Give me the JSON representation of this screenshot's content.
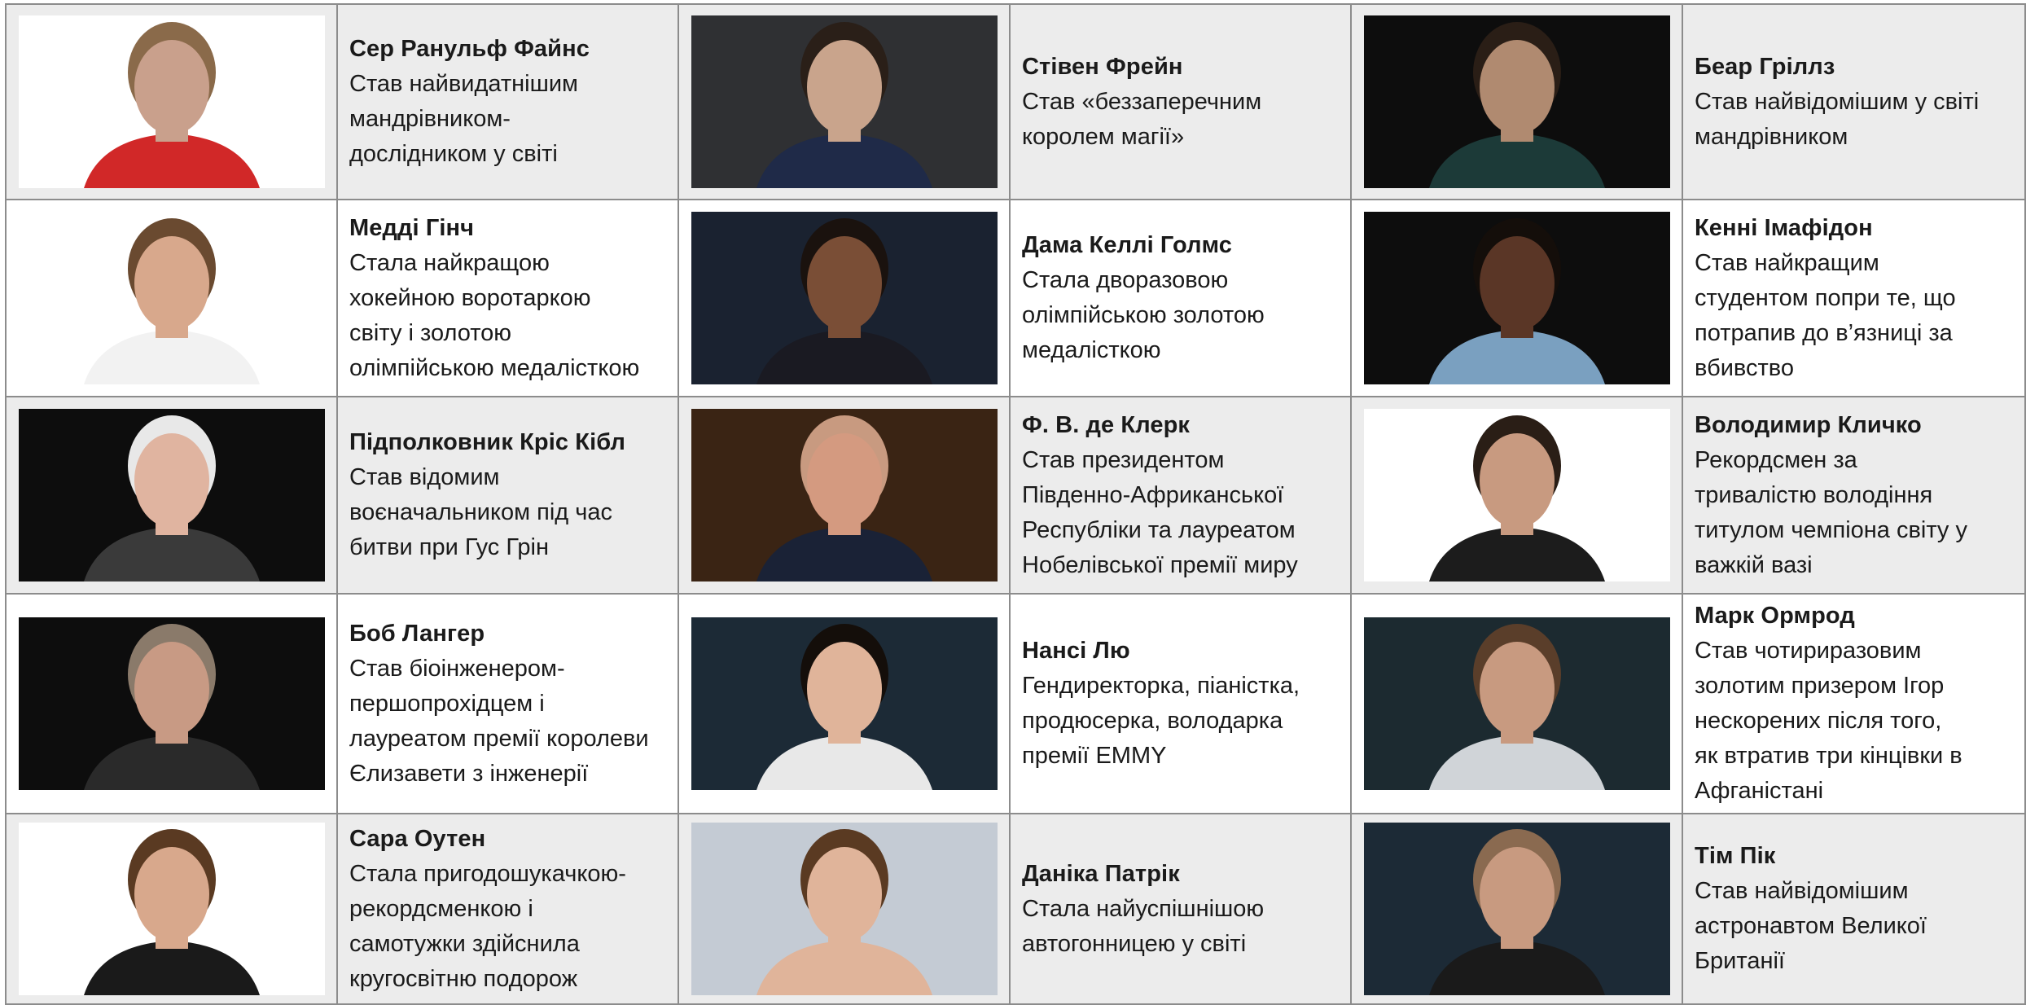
{
  "people": [
    {
      "name": "Сер Ранульф Файнс",
      "description": "Став найвидатнішим\nмандрівником-\nдослідником у світі",
      "photo_bg": "#ffffff",
      "skin": "#c9a08c",
      "hair": "#8a6a4a",
      "cloth": "#d12828"
    },
    {
      "name": "Стівен Фрейн",
      "description": "Став «беззаперечним\nкоролем магії»",
      "photo_bg": "#2f3033",
      "skin": "#c9a48c",
      "hair": "#2a1f18",
      "cloth": "#1f2a48"
    },
    {
      "name": "Беар Гріллз",
      "description": "Став найвідомішим у світі\nмандрівником",
      "photo_bg": "#0d0d0d",
      "skin": "#b08a70",
      "hair": "#2a1e16",
      "cloth": "#1c3a38"
    },
    {
      "name": "Медді Гінч",
      "description": "Стала найкращою\nхокейною воротаркою\nсвіту і золотою\nолімпійською медалісткою",
      "photo_bg": "#ffffff",
      "skin": "#d8a88c",
      "hair": "#6a4a30",
      "cloth": "#f2f2f2"
    },
    {
      "name": "Дама Келлі Голмс",
      "description": "Стала дворазовою\nолімпійською золотою\nмедалісткою",
      "photo_bg": "#1a2230",
      "skin": "#7a4e36",
      "hair": "#1a120e",
      "cloth": "#1a1a22"
    },
    {
      "name": "Кенні Імафідон",
      "description": "Став найкращим\nстудентом попри те, що\nпотрапив до в’язниці за\nвбивство",
      "photo_bg": "#0d0d0d",
      "skin": "#5a3626",
      "hair": "#140e0a",
      "cloth": "#7aa0c0"
    },
    {
      "name": "Підполковник Кріс Кібл",
      "description": "Став відомим\nвоєначальником під час\nбитви при Гус Грін",
      "photo_bg": "#0d0d0d",
      "skin": "#e0b4a0",
      "hair": "#e8e8e8",
      "cloth": "#3a3a3a"
    },
    {
      "name": "Ф. В. де Клерк",
      "description": "Став президентом\nПівденно-Африканської\nРеспубліки та лауреатом\nНобелівської премії миру",
      "photo_bg": "#3a2414",
      "skin": "#d49a80",
      "hair": "#c89a80",
      "cloth": "#1a2236"
    },
    {
      "name": "Володимир Кличко",
      "description": "Рекордсмен за\nтривалістю володіння\nтитулом чемпіона світу у\nважкій вазі",
      "photo_bg": "#ffffff",
      "skin": "#c89a80",
      "hair": "#2a1e16",
      "cloth": "#1c1c1c"
    },
    {
      "name": "Боб Лангер",
      "description": "Став біоінженером-\nпершопрохідцем і\nлауреатом премії королеви\nЄлизавети з інженерії",
      "photo_bg": "#0d0d0d",
      "skin": "#c89a84",
      "hair": "#8a7a6a",
      "cloth": "#2a2a2a"
    },
    {
      "name": "Нансі Лю",
      "description": "Гендиректорка, піаністка,\nпродюсерка, володарка\nпремії EMMY",
      "photo_bg": "#1c2a36",
      "skin": "#e0b49a",
      "hair": "#140e0a",
      "cloth": "#e8e8e8"
    },
    {
      "name": "Марк Ормрод",
      "description": "Став чотириразовим\nзолотим призером Ігор\nнескорених після того,\nяк втратив три кінцівки в\nАфганістані",
      "photo_bg": "#1c2a30",
      "skin": "#c89a80",
      "hair": "#5a3e2a",
      "cloth": "#d0d4d8"
    },
    {
      "name": "Сара Оутен",
      "description": "Стала пригодошукачкою-\nрекордсменкою і\nсамотужки здійснила\nкругосвітню подорож",
      "photo_bg": "#ffffff",
      "skin": "#d8a88c",
      "hair": "#5a3a22",
      "cloth": "#1a1a1a"
    },
    {
      "name": "Даніка Патрік",
      "description": "Стала найуспішнішою\nавтогонницею у світі",
      "photo_bg": "#c4cbd4",
      "skin": "#e0b49a",
      "hair": "#5a3a22",
      "cloth": "#e0b49a"
    },
    {
      "name": "Тім Пік",
      "description": "Став найвідомішим\nастронавтом Великої\nБританії",
      "photo_bg": "#1c2a36",
      "skin": "#c89a80",
      "hair": "#8a6a50",
      "cloth": "#1a1a1a"
    }
  ]
}
